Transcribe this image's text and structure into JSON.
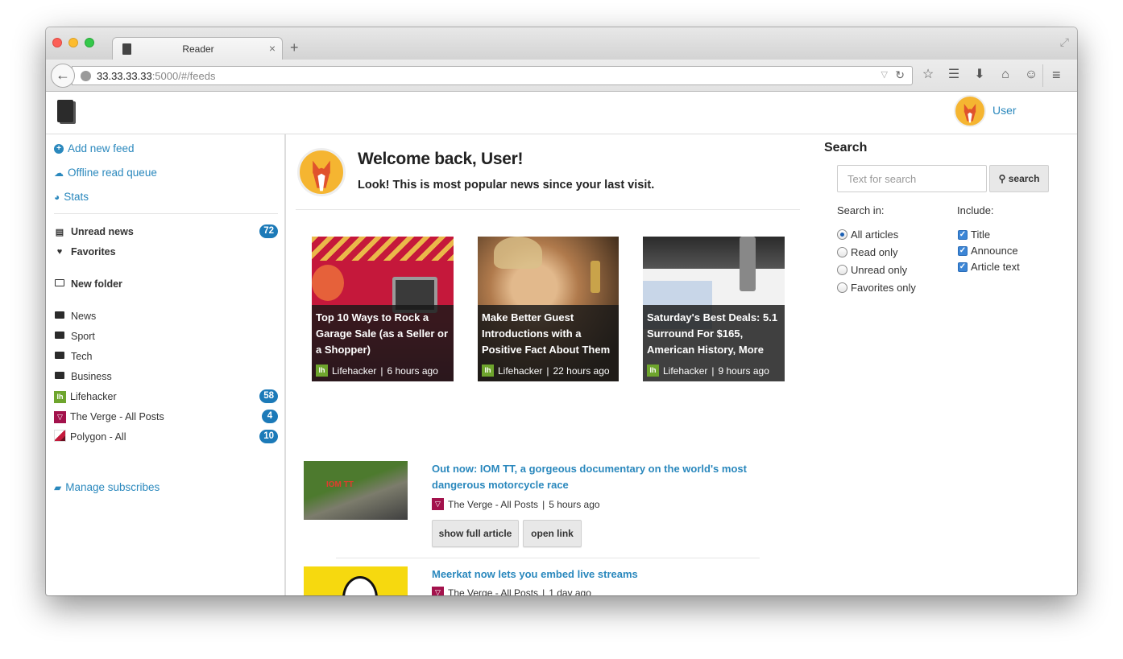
{
  "browser": {
    "tab_title": "Reader",
    "tab_close": "×",
    "new_tab": "+",
    "url_host": "33.33.33.33",
    "url_path": ":5000/#/feeds"
  },
  "header": {
    "user_label": "User"
  },
  "sidebar": {
    "add_feed": "Add new feed",
    "offline_queue": "Offline read queue",
    "stats": "Stats",
    "unread_label": "Unread news",
    "unread_count": "72",
    "favorites_label": "Favorites",
    "new_folder": "New folder",
    "folders": [
      "News",
      "Sport",
      "Tech",
      "Business"
    ],
    "feeds": [
      {
        "label": "Lifehacker",
        "count": "58"
      },
      {
        "label": "The Verge - All Posts",
        "count": "4"
      },
      {
        "label": "Polygon - All",
        "count": "10"
      }
    ],
    "manage": "Manage subscribes"
  },
  "main": {
    "welcome": "Welcome back, User!",
    "subtitle": "Look! This is most popular news since your last visit.",
    "cards": [
      {
        "title": "Top 10 Ways to Rock a Garage Sale (as a Seller or a Shopper)",
        "source": "Lifehacker",
        "time": "6 hours ago"
      },
      {
        "title": "Make Better Guest Introductions with a Positive Fact About Them",
        "source": "Lifehacker",
        "time": "22 hours ago"
      },
      {
        "title": "Saturday's Best Deals: 5.1 Surround For $165, American History, More",
        "source": "Lifehacker",
        "time": "9 hours ago"
      }
    ],
    "articles": [
      {
        "title": "Out now: IOM TT, a gorgeous documentary on the world's most dangerous motorcycle race",
        "source": "The Verge - All Posts",
        "time": "5 hours ago",
        "thumb_text": "IOM TT"
      },
      {
        "title": "Meerkat now lets you embed live streams",
        "source": "The Verge - All Posts",
        "time": "1 day ago"
      }
    ],
    "show_full": "show full article",
    "open_link": "open link",
    "separator": " | "
  },
  "search": {
    "heading": "Search",
    "placeholder": "Text for search",
    "button": "search",
    "search_in_label": "Search in:",
    "include_label": "Include:",
    "search_in": [
      "All articles",
      "Read only",
      "Unread only",
      "Favorites only"
    ],
    "include": [
      "Title",
      "Announce",
      "Article text"
    ]
  },
  "colors": {
    "link": "#2a88bd",
    "badge": "#1c7ab8",
    "lifehacker": "#6ea52d",
    "verge": "#a3124c"
  }
}
